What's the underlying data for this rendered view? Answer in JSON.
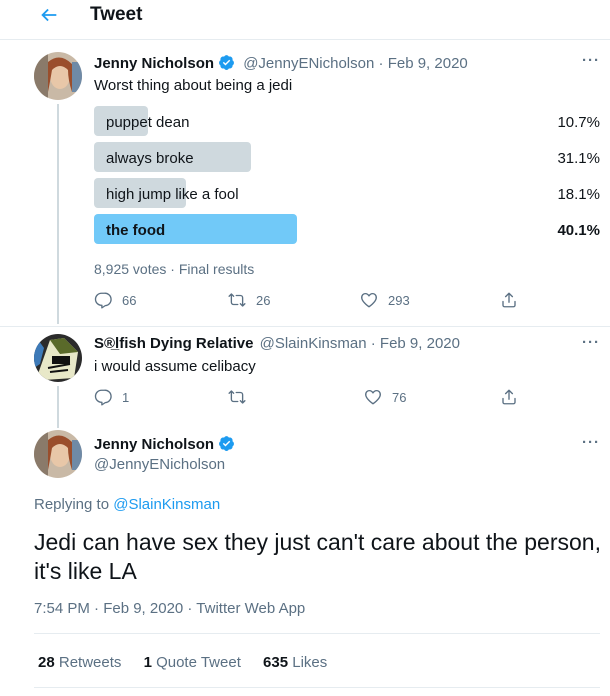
{
  "header": {
    "title": "Tweet"
  },
  "tweet1": {
    "display_name": "Jenny Nicholson",
    "handle": "@JennyENicholson",
    "date": "Feb 9, 2020",
    "text": "Worst thing about being a jedi",
    "poll": {
      "options": [
        {
          "label": "puppet dean",
          "percent": "10.7%",
          "fraction": 0.107,
          "winner": false
        },
        {
          "label": "always broke",
          "percent": "31.1%",
          "fraction": 0.311,
          "winner": false
        },
        {
          "label": "high jump like a fool",
          "percent": "18.1%",
          "fraction": 0.181,
          "winner": false
        },
        {
          "label": "the food",
          "percent": "40.1%",
          "fraction": 0.401,
          "winner": true
        }
      ],
      "summary": "8,925 votes · Final results"
    },
    "actions": {
      "replies": "66",
      "retweets": "26",
      "likes": "293"
    }
  },
  "tweet2": {
    "display_name": "S®̲lfish Dying Relative",
    "handle": "@SlainKinsman",
    "date": "Feb 9, 2020",
    "text": "i would assume celibacy",
    "actions": {
      "replies": "1",
      "retweets": "",
      "likes": "76"
    }
  },
  "main_tweet": {
    "display_name": "Jenny Nicholson",
    "handle": "@JennyENicholson",
    "replying_prefix": "Replying to",
    "replying_to": "@SlainKinsman",
    "text": "Jedi can have sex they just can't care about the person, it's like LA",
    "timestamp": "7:54 PM · Feb 9, 2020 · Twitter Web App",
    "stats": {
      "retweets_count": "28",
      "retweets_label": "Retweets",
      "quotes_count": "1",
      "quotes_label": "Quote Tweet",
      "likes_count": "635",
      "likes_label": "Likes"
    }
  },
  "colors": {
    "accent": "#1d9bf0",
    "poll_winner": "#71c9f8",
    "poll_bar": "#cfd9de",
    "muted": "#5b7083"
  }
}
